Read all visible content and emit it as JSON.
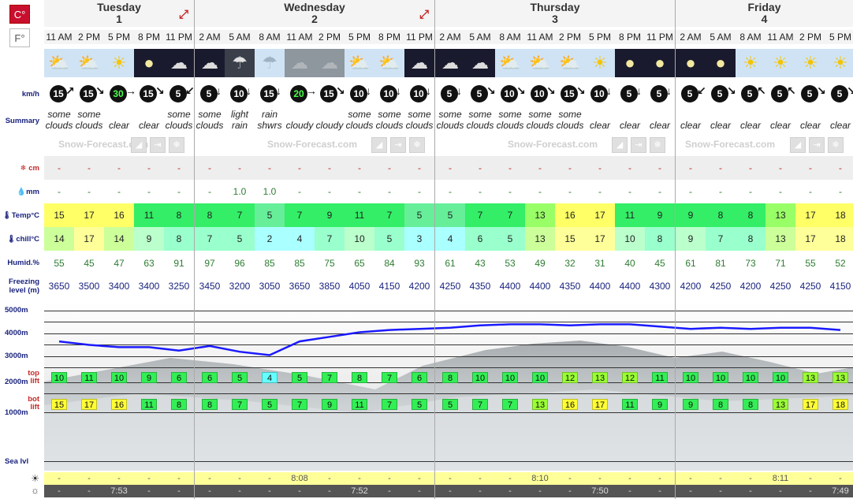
{
  "units": {
    "celsius": "C°",
    "fahrenheit": "F°"
  },
  "labels": {
    "wind": "km/h",
    "summary": "Summary",
    "snow": "cm",
    "rain": "mm",
    "temp": "Temp°C",
    "chill": "chill°C",
    "humid": "Humid.%",
    "freezing_line1": "Freezing",
    "freezing_line2": "level (m)",
    "m5000": "5000m",
    "m4000": "4000m",
    "m3000": "3000m",
    "m2000": "2000m",
    "m1000": "1000m",
    "sea": "Sea lvl",
    "top_lift_1": "top",
    "top_lift_2": "lift",
    "bot_lift_1": "bot",
    "bot_lift_2": "lift"
  },
  "brand": "Snow-Forecast.com",
  "days": [
    {
      "name": "Tuesday",
      "num": "1",
      "cols": 5
    },
    {
      "name": "Wednesday",
      "num": "2",
      "cols": 8
    },
    {
      "name": "Thursday",
      "num": "3",
      "cols": 8
    },
    {
      "name": "Friday",
      "num": "4",
      "cols": 6
    }
  ],
  "times": [
    "11 AM",
    "2 PM",
    "5 PM",
    "8 PM",
    "11 PM",
    "2 AM",
    "5 AM",
    "8 AM",
    "11 AM",
    "2 PM",
    "5 PM",
    "8 PM",
    "11 PM",
    "2 AM",
    "5 AM",
    "8 AM",
    "11 AM",
    "2 PM",
    "5 PM",
    "8 PM",
    "11 PM",
    "2 AM",
    "5 AM",
    "8 AM",
    "11 AM",
    "2 PM",
    "5 PM"
  ],
  "icons": [
    "partly-cloudy-sun",
    "partly-cloudy-sun",
    "sun",
    "moon",
    "partly-cloudy-moon",
    "partly-cloudy-moon",
    "cloud-drizzle-night",
    "cloud-drizzle-day",
    "cloud",
    "cloud",
    "partly-cloudy-sun",
    "partly-cloudy-sun",
    "partly-cloudy-moon",
    "partly-cloudy-moon",
    "partly-cloudy-moon",
    "partly-cloudy-sun",
    "partly-cloudy-sun",
    "partly-cloudy-sun",
    "sun",
    "moon",
    "moon",
    "moon",
    "moon",
    "sun",
    "sun",
    "sun",
    "sun"
  ],
  "wind_speed": [
    "15",
    "15",
    "30",
    "15",
    "5",
    "5",
    "10",
    "15",
    "20",
    "15",
    "10",
    "10",
    "10",
    "5",
    "5",
    "10",
    "10",
    "15",
    "10",
    "5",
    "5",
    "5",
    "5",
    "5",
    "5",
    "5",
    "5"
  ],
  "wind_dir": [
    "↗",
    "↘",
    "→",
    "↘",
    "↙",
    "↓",
    "↓",
    "↓",
    "→",
    "↘",
    "↓",
    "↓",
    "↓",
    "↓",
    "↘",
    "↘",
    "↘",
    "↘",
    "↓",
    "↓",
    "↓",
    "↙",
    "↘",
    "↖",
    "↖",
    "↘",
    "↘"
  ],
  "summary": [
    [
      "some",
      "clouds"
    ],
    [
      "some",
      "clouds"
    ],
    [
      "",
      "clear"
    ],
    [
      "",
      "clear"
    ],
    [
      "some",
      "clouds"
    ],
    [
      "some",
      "clouds"
    ],
    [
      "light",
      "rain"
    ],
    [
      "rain",
      "shwrs"
    ],
    [
      "",
      "cloudy"
    ],
    [
      "",
      "cloudy"
    ],
    [
      "some",
      "clouds"
    ],
    [
      "some",
      "clouds"
    ],
    [
      "some",
      "clouds"
    ],
    [
      "some",
      "clouds"
    ],
    [
      "some",
      "clouds"
    ],
    [
      "some",
      "clouds"
    ],
    [
      "some",
      "clouds"
    ],
    [
      "some",
      "clouds"
    ],
    [
      "",
      "clear"
    ],
    [
      "",
      "clear"
    ],
    [
      "",
      "clear"
    ],
    [
      "",
      "clear"
    ],
    [
      "",
      "clear"
    ],
    [
      "",
      "clear"
    ],
    [
      "",
      "clear"
    ],
    [
      "",
      "clear"
    ],
    [
      "",
      "clear"
    ]
  ],
  "snow": [
    "-",
    "-",
    "-",
    "-",
    "-",
    "-",
    "-",
    "-",
    "-",
    "-",
    "-",
    "-",
    "-",
    "-",
    "-",
    "-",
    "-",
    "-",
    "-",
    "-",
    "-",
    "-",
    "-",
    "-",
    "-",
    "-",
    "-"
  ],
  "rain": [
    "-",
    "-",
    "-",
    "-",
    "-",
    "-",
    "1.0",
    "1.0",
    "-",
    "-",
    "-",
    "-",
    "-",
    "-",
    "-",
    "-",
    "-",
    "-",
    "-",
    "-",
    "-",
    "-",
    "-",
    "-",
    "-",
    "-",
    "-"
  ],
  "temp": [
    "15",
    "17",
    "16",
    "11",
    "8",
    "8",
    "7",
    "5",
    "7",
    "9",
    "11",
    "7",
    "5",
    "5",
    "7",
    "7",
    "13",
    "16",
    "17",
    "11",
    "9",
    "9",
    "8",
    "8",
    "13",
    "17",
    "18"
  ],
  "chill": [
    "14",
    "17",
    "14",
    "9",
    "8",
    "7",
    "5",
    "2",
    "4",
    "7",
    "10",
    "5",
    "3",
    "4",
    "6",
    "5",
    "13",
    "15",
    "17",
    "10",
    "8",
    "9",
    "7",
    "8",
    "13",
    "17",
    "18"
  ],
  "humid": [
    "55",
    "45",
    "47",
    "63",
    "91",
    "97",
    "96",
    "85",
    "85",
    "75",
    "65",
    "84",
    "93",
    "61",
    "43",
    "53",
    "49",
    "32",
    "31",
    "40",
    "45",
    "61",
    "81",
    "73",
    "71",
    "55",
    "52"
  ],
  "freezing": [
    "3650",
    "3500",
    "3400",
    "3400",
    "3250",
    "3450",
    "3200",
    "3050",
    "3650",
    "3850",
    "4050",
    "4150",
    "4200",
    "4250",
    "4350",
    "4400",
    "4400",
    "4350",
    "4400",
    "4400",
    "4300",
    "4200",
    "4250",
    "4200",
    "4250",
    "4250",
    "4150"
  ],
  "top_lift": [
    "10",
    "11",
    "10",
    "9",
    "6",
    "6",
    "5",
    "4",
    "5",
    "7",
    "8",
    "7",
    "6",
    "8",
    "10",
    "10",
    "10",
    "12",
    "13",
    "12",
    "11",
    "10",
    "10",
    "10",
    "10",
    "13",
    "13"
  ],
  "bot_lift": [
    "15",
    "17",
    "16",
    "11",
    "8",
    "8",
    "7",
    "5",
    "7",
    "9",
    "11",
    "7",
    "5",
    "5",
    "7",
    "7",
    "13",
    "16",
    "17",
    "11",
    "9",
    "9",
    "8",
    "8",
    "13",
    "17",
    "18"
  ],
  "sunrise": {
    "tue": "-",
    "wed": "8:08",
    "thu": "8:10",
    "fri": "8:11"
  },
  "sunset": {
    "tue": "7:53",
    "wed": "7:52",
    "thu": "7:50",
    "fri": "7:49"
  },
  "colors": {
    "t18": "#ffff66",
    "t17": "#ffff66",
    "t16": "#ffff66",
    "t15": "#ffff66",
    "t14": "#ccff99",
    "t13": "#99ff66",
    "t12": "#66ff66",
    "t11": "#33ee66",
    "t10": "#33ee66",
    "t9": "#33ee66",
    "t8": "#33ee66",
    "t7": "#33ee66",
    "t6": "#66ee99",
    "t5": "#66ee99",
    "t4": "#99ffff",
    "t3": "#99ffff",
    "t2": "#99ffff"
  }
}
